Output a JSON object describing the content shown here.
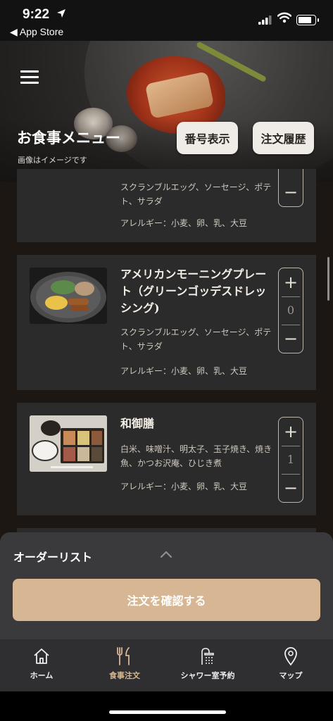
{
  "status_bar": {
    "time": "9:22",
    "back_label": "◀ App Store"
  },
  "header": {
    "title": "お食事メニュー",
    "subtitle": "画像はイメージです",
    "number_button": "番号表示",
    "history_button": "注文履歴"
  },
  "menu_items": [
    {
      "name": "",
      "description": "スクランブルエッグ、ソーセージ、ポテト、サラダ",
      "allergy": "アレルギー：小麦、卵、乳、大豆",
      "quantity": ""
    },
    {
      "name": "アメリカンモーニングプレート（グリーンゴッデスドレッシング)",
      "description": "スクランブルエッグ、ソーセージ、ポテト、サラダ",
      "allergy": "アレルギー：小麦、卵、乳、大豆",
      "quantity": "0"
    },
    {
      "name": "和御膳",
      "description": "白米、味噌汁、明太子、玉子焼き、焼き魚、かつお沢庵、ひじき煮",
      "allergy": "アレルギー：小麦、卵、乳、大豆",
      "quantity": "1"
    }
  ],
  "stepper": {
    "plus": "+",
    "minus": "−"
  },
  "order_sheet": {
    "label": "オーダーリスト",
    "confirm_button": "注文を確認する"
  },
  "tabs": [
    {
      "label": "ホーム",
      "icon": "home-icon",
      "active": false
    },
    {
      "label": "食事注文",
      "icon": "utensils-icon",
      "active": true
    },
    {
      "label": "シャワー室予約",
      "icon": "shower-icon",
      "active": false
    },
    {
      "label": "マップ",
      "icon": "map-pin-icon",
      "active": false
    }
  ],
  "colors": {
    "accent": "#d7b793",
    "card_bg": "#2b2b2b",
    "sheet_bg": "#3a3a3c"
  }
}
